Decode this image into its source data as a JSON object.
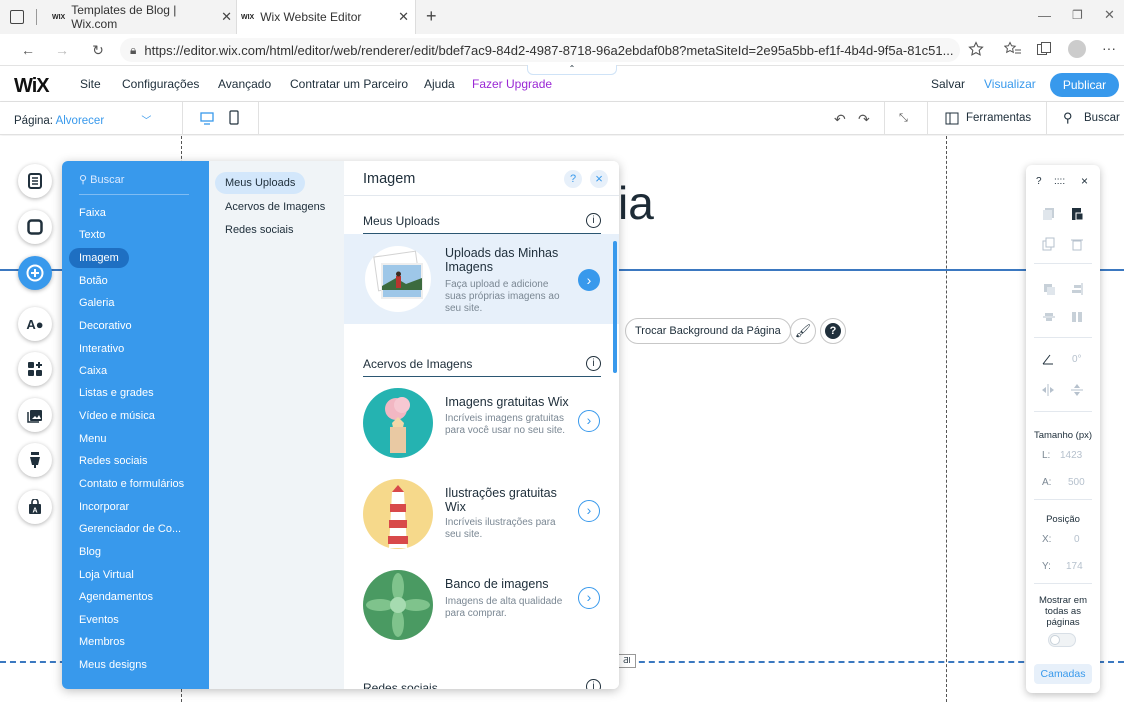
{
  "browser": {
    "tabs": [
      {
        "favicon": "WIX",
        "title": "Templates de Blog | Wix.com"
      },
      {
        "favicon": "WIX",
        "title": "Wix Website Editor"
      }
    ],
    "url": "https://editor.wix.com/html/editor/web/renderer/edit/bdef7ac9-84d2-4987-8718-96a2ebdaf0b8?metaSiteId=2e95a5bb-ef1f-4b4d-9f5a-81c51..."
  },
  "wix_top": {
    "logo": "WiX",
    "menu": [
      "Site",
      "Configurações",
      "Avançado",
      "Contratar um Parceiro",
      "Ajuda",
      "Fazer Upgrade"
    ],
    "save": "Salvar",
    "preview": "Visualizar",
    "publish": "Publicar"
  },
  "sub_bar": {
    "page_label": "Página:",
    "page_name": "Alvorecer",
    "tools": "Ferramentas",
    "search": "Buscar"
  },
  "canvas": {
    "heading_fragment": "ia",
    "change_bg": "Trocar Background da Página",
    "strip_tag": "ƋI"
  },
  "add_panel": {
    "search": "Buscar",
    "categories": [
      "Faixa",
      "Texto",
      "Imagem",
      "Botão",
      "Galeria",
      "Decorativo",
      "Interativo",
      "Caixa",
      "Listas e grades",
      "Vídeo e música",
      "Menu",
      "Redes sociais",
      "Contato e formulários",
      "Incorporar",
      "Gerenciador de Co...",
      "Blog",
      "Loja Virtual",
      "Agendamentos",
      "Eventos",
      "Membros",
      "Meus designs"
    ],
    "active_category": "Imagem",
    "subcategories": [
      "Meus Uploads",
      "Acervos de Imagens",
      "Redes sociais"
    ],
    "active_subcategory": "Meus Uploads",
    "title": "Imagem",
    "help": "?",
    "close": "×",
    "sections": [
      {
        "title": "Meus Uploads",
        "info": "i"
      },
      {
        "title": "Acervos de Imagens",
        "info": "i"
      },
      {
        "title": "Redes sociais",
        "info": "i"
      }
    ],
    "cards": [
      {
        "title": "Uploads das Minhas Imagens",
        "desc": "Faça upload e adicione suas próprias imagens ao seu site."
      },
      {
        "title": "Imagens gratuitas Wix",
        "desc": "Incríveis imagens gratuitas para você usar no seu site."
      },
      {
        "title": "Ilustrações gratuitas Wix",
        "desc": "Incríveis ilustrações para seu site."
      },
      {
        "title": "Banco de imagens",
        "desc": "Imagens de alta qualidade para comprar."
      }
    ]
  },
  "props_panel": {
    "help": "?",
    "close": "×",
    "rotation": "0°",
    "size_label": "Tamanho (px)",
    "width_label": "L:",
    "width_value": "1423",
    "height_label": "A:",
    "height_value": "500",
    "position_label": "Posição",
    "x_label": "X:",
    "x_value": "0",
    "y_label": "Y:",
    "y_value": "174",
    "show_all": "Mostrar em todas as páginas",
    "layers": "Camadas"
  },
  "colors": {
    "accent": "#3899ec",
    "upgrade": "#9a27d5",
    "text": "#20303c"
  }
}
